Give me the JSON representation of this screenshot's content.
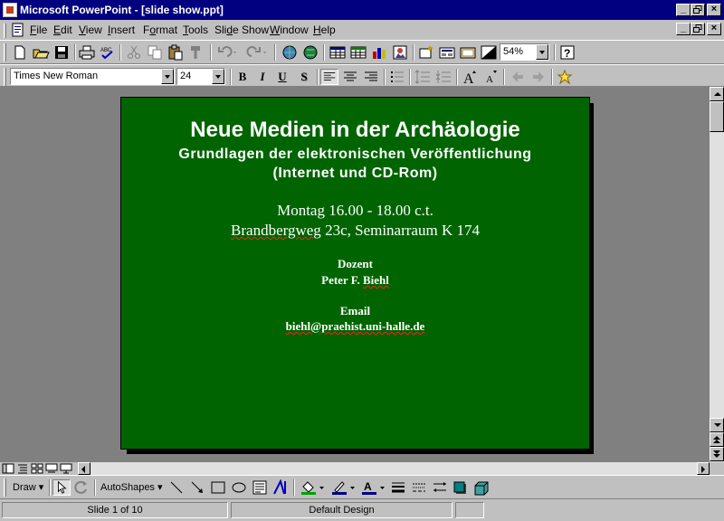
{
  "window": {
    "title": "Microsoft PowerPoint - [slide show.ppt]"
  },
  "menubar": {
    "items": [
      "File",
      "Edit",
      "View",
      "Insert",
      "Format",
      "Tools",
      "Slide Show",
      "Window",
      "Help"
    ],
    "mnemonics": [
      "F",
      "E",
      "V",
      "I",
      "o",
      "T",
      "d",
      "W",
      "H"
    ]
  },
  "standard_toolbar": {
    "zoom": "54%"
  },
  "formatting_toolbar": {
    "font_name": "Times New Roman",
    "font_size": "24",
    "bold_label": "B",
    "italic_label": "I",
    "underline_label": "U",
    "shadow_label": "S"
  },
  "slide": {
    "background_color": "#006400",
    "title": "Neue Medien in der Archäologie",
    "subtitle_line1": "Grundlagen der elektronischen Veröffentlichung",
    "subtitle_line2": "(Internet und CD-Rom)",
    "time": "Montag 16.00 - 18.00 c.t.",
    "location_street": "Brandbergweg",
    "location_rest": " 23c, Seminarraum K 174",
    "lecturer_heading": "Dozent",
    "lecturer_first": "Peter F. ",
    "lecturer_last": "Biehl",
    "email_heading": "Email",
    "email": "biehl@praehist.uni-halle.de"
  },
  "drawing_toolbar": {
    "draw_label": "Draw",
    "autoshapes_label": "AutoShapes",
    "fill_color": "#00a000",
    "line_color": "#000080",
    "font_color": "#000080"
  },
  "statusbar": {
    "slide_indicator": "Slide 1 of 10",
    "design": "Default Design"
  }
}
